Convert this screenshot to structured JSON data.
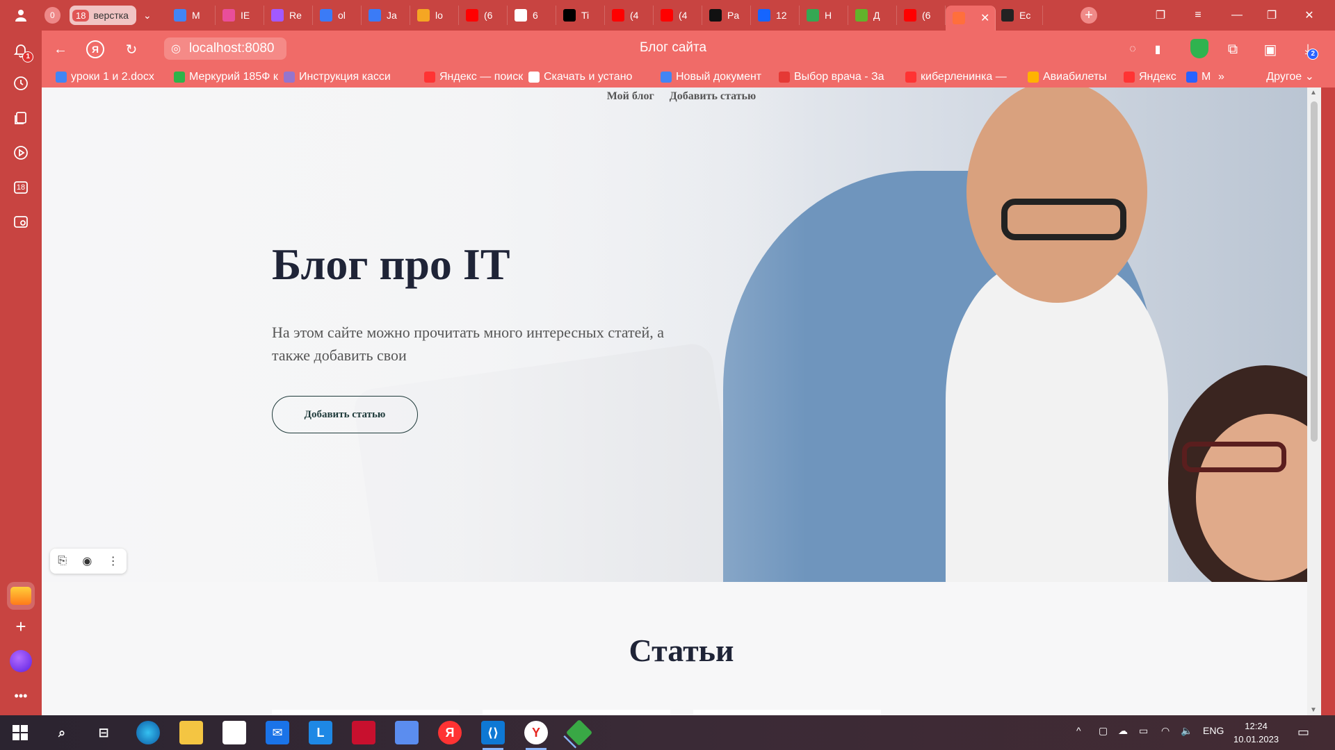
{
  "browser": {
    "tab_count_badge": "0",
    "tab_group": {
      "count": "18",
      "label": "верстка"
    },
    "tabs": [
      {
        "label": "M",
        "color": "#4285f4"
      },
      {
        "label": "IE",
        "color": "#e94e9a"
      },
      {
        "label": "Re",
        "color": "#a259ff"
      },
      {
        "label": "ol",
        "color": "#3b7bf6"
      },
      {
        "label": "Ja",
        "color": "#3b7bf6"
      },
      {
        "label": "lo",
        "color": "#f5a623"
      },
      {
        "label": "(6",
        "color": "#ff0000"
      },
      {
        "label": "6",
        "color": "#ffffff"
      },
      {
        "label": "Ti",
        "color": "#000000"
      },
      {
        "label": "(4",
        "color": "#ff0000"
      },
      {
        "label": "(4",
        "color": "#ff0000"
      },
      {
        "label": "Pa",
        "color": "#111111"
      },
      {
        "label": "12",
        "color": "#1565ff"
      },
      {
        "label": "H",
        "color": "#34a853"
      },
      {
        "label": "Д",
        "color": "#62b32b"
      },
      {
        "label": "(6",
        "color": "#ff0000"
      },
      {
        "label": "",
        "color": "#ff6f3c",
        "active": true
      },
      {
        "label": "Ec",
        "color": "#222222"
      }
    ],
    "url": "localhost:8080",
    "page_title": "Блог сайта",
    "sidebar_notification_count": "1",
    "downloads_count": "2"
  },
  "bookmarks": [
    {
      "label": "уроки 1 и 2.docx",
      "color": "#4285f4"
    },
    {
      "label": "Меркурий 185Ф к",
      "color": "#2db34a"
    },
    {
      "label": "Инструкция касси",
      "color": "#9575cd"
    },
    {
      "label": "Яндекс — поиск",
      "color": "#ff3333"
    },
    {
      "label": "Скачать и устано",
      "color": "#ffffff"
    },
    {
      "label": "Новый документ",
      "color": "#4285f4"
    },
    {
      "label": "Выбор врача - За",
      "color": "#e53935"
    },
    {
      "label": "киберленинка —",
      "color": "#ff3333"
    },
    {
      "label": "Авиабилеты",
      "color": "#ffb300"
    },
    {
      "label": "Яндекс",
      "color": "#ff3333"
    },
    {
      "label": "М",
      "color": "#2962ff"
    }
  ],
  "bookmarks_other": "Другое",
  "page": {
    "nav": [
      {
        "label": "Мой блог"
      },
      {
        "label": "Добавить статью"
      }
    ],
    "hero": {
      "title": "Блог про IT",
      "subtitle": "На этом сайте можно прочитать много интересных статей, а также добавить свои",
      "button": "Добавить статью"
    },
    "articles_title": "Статьи"
  },
  "taskbar": {
    "apps": [
      "Start",
      "Search",
      "Task View",
      "Edge",
      "Explorer",
      "Store",
      "Mail",
      "L",
      "McAfee",
      "Network",
      "Я",
      "VS Code",
      "Yandex Browser",
      "Git"
    ],
    "language": "ENG",
    "time": "12:24",
    "date": "10.01.2023"
  }
}
